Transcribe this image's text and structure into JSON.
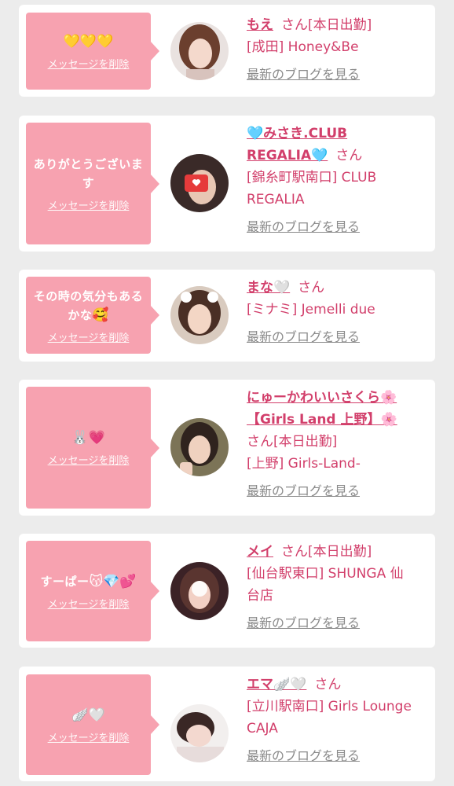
{
  "common": {
    "delete_label": "メッセージを削除",
    "blog_label": "最新のブログを見る",
    "san": "さん"
  },
  "cards": [
    {
      "message": "",
      "message_emoji": "💛💛💛",
      "name": "もえ",
      "name_line2": "",
      "suffix": "[本日出勤]",
      "shop": "[成田] Honey&Be",
      "shop2": ""
    },
    {
      "message": "ありがとうございます",
      "message_emoji": "",
      "name": "🩵みさき.CLUB",
      "name_line2": "REGALIA🩵",
      "suffix": "",
      "shop": "[錦糸町駅南口] CLUB",
      "shop2": "REGALIA"
    },
    {
      "message": "その時の気分もあるかな",
      "message_emoji": "🥰",
      "name": "まな🤍",
      "name_line2": "",
      "suffix": "",
      "shop": "[ミナミ] Jemelli due",
      "shop2": ""
    },
    {
      "message": "",
      "message_emoji": "🐰💗",
      "name": "にゅーかわいいさくら🌸",
      "name_line2": "【Girls Land 上野】🌸",
      "suffix": "[本日出勤]",
      "shop": "[上野] Girls-Land-",
      "shop2": ""
    },
    {
      "message": "すーぱー",
      "message_emoji": "😽💎💕",
      "name": "メイ",
      "name_line2": "",
      "suffix": "[本日出勤]",
      "shop": "[仙台駅東口] SHUNGA 仙",
      "shop2": "台店"
    },
    {
      "message": "",
      "message_emoji": "🪽🤍",
      "name": "エマ🪽🤍",
      "name_line2": "",
      "suffix": "",
      "shop": "[立川駅南口] Girls Lounge",
      "shop2": "CAJA"
    }
  ]
}
